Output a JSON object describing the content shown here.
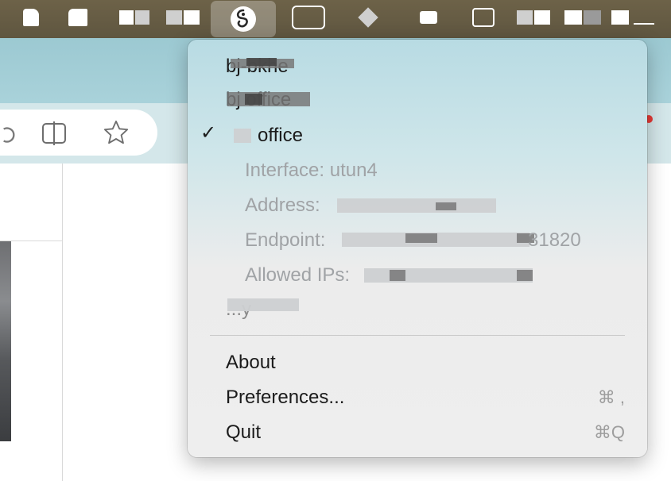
{
  "menu_bar": {
    "icons": [
      "app-icon-1",
      "app-icon-2",
      "app-icon-3",
      "app-icon-4",
      "wireguard-icon",
      "app-icon-6",
      "app-icon-7",
      "app-icon-8",
      "app-icon-9",
      "app-icon-10",
      "app-icon-11",
      "app-icon-12"
    ]
  },
  "menu": {
    "tunnels": [
      {
        "name": "bj-bkhe",
        "active": false
      },
      {
        "name": "bj office",
        "active": false
      },
      {
        "name": "office",
        "active": true
      },
      {
        "name": "...y",
        "active": false
      }
    ],
    "details": {
      "interface": "Interface: utun4",
      "address": "Address:",
      "endpoint": "Endpoint:",
      "endpoint_tail": "31820",
      "allowed_ips": "Allowed IPs:"
    },
    "check_mark": "✓",
    "items": {
      "about": "About",
      "preferences": "Preferences...",
      "preferences_shortcut": "⌘ ,",
      "quit": "Quit",
      "quit_shortcut": "⌘Q"
    }
  }
}
